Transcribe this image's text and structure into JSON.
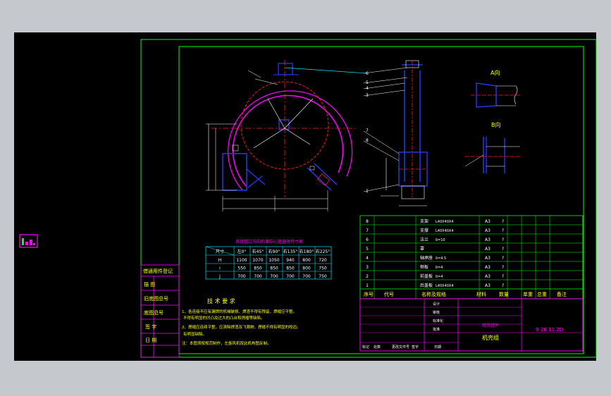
{
  "colors": {
    "background": "#c5c9cd",
    "sheet": "#000000",
    "frame": "#00ff00",
    "magenta": "#ff00ff",
    "blue": "#2a3cff",
    "red": "#ff2020",
    "yellow": "#ffff00",
    "cyan": "#00e5ff",
    "white": "#ffffff"
  },
  "views": {
    "view_a_label": "A向",
    "view_b_label": "B向"
  },
  "dims_table": {
    "title": "各接管口方向的离中心管直径尺寸表",
    "header": [
      "尺寸",
      "左0°",
      "右45°",
      "右90°",
      "右135°",
      "右180°",
      "右225°"
    ],
    "rows": [
      [
        "H",
        "1100",
        "1070",
        "1050",
        "940",
        "800",
        "720"
      ],
      [
        "i",
        "550",
        "850",
        "850",
        "850",
        "800",
        "750"
      ],
      [
        "j",
        "700",
        "700",
        "700",
        "700",
        "700",
        "750"
      ]
    ]
  },
  "bom": {
    "rows": [
      [
        "8",
        "支架",
        "L40X40X4",
        "A3",
        "?",
        ""
      ],
      [
        "7",
        "支撑",
        "L40X40X4",
        "A3",
        "?",
        ""
      ],
      [
        "6",
        "法兰",
        "δ=10",
        "A3",
        "?",
        ""
      ],
      [
        "5",
        "罩",
        "",
        "A3",
        "?",
        ""
      ],
      [
        "4",
        "轴承座",
        "δ=4.5",
        "A3",
        "?",
        ""
      ],
      [
        "3",
        "侧板",
        "δ=4",
        "A3",
        "?",
        ""
      ],
      [
        "2",
        "前盖板",
        "δ=4",
        "A3",
        "?",
        ""
      ],
      [
        "1",
        "后盖板",
        "L40X40X4",
        "A3",
        "?",
        ""
      ]
    ],
    "header": [
      "序号",
      "代号",
      "名称及规格",
      "材料",
      "数量",
      "单重",
      "总重",
      "备注"
    ]
  },
  "tech_req": {
    "title": "技 术 要 求",
    "lines": [
      "1、各连接不应有漏焊的机械破损、焊渣不得有残留，焊缝应平整。",
      "不得有明显的凹凸及过大的凸台和焊瘤等缺陷。",
      "2、焊缝应连续平整，应清除焊渣及飞溅物，焊缝不得有明显的咬边。",
      "有明显缺陷。",
      "注：本图须按规范制作，左旋风机按此机构图反制。"
    ]
  },
  "left_panel": {
    "labels": [
      "借通用件登记",
      "描  图",
      "旧底图总号",
      "底图总号",
      "签  字",
      "日  期"
    ]
  },
  "title_block": {
    "code": "9-26 11.2D",
    "part_name": "机壳组",
    "material_note": "机壳组件",
    "rows": [
      "设计",
      "审核",
      "标准化",
      "批准"
    ],
    "bottom": [
      "标记",
      "处数",
      "更改文件号",
      "签字",
      "日期"
    ]
  }
}
